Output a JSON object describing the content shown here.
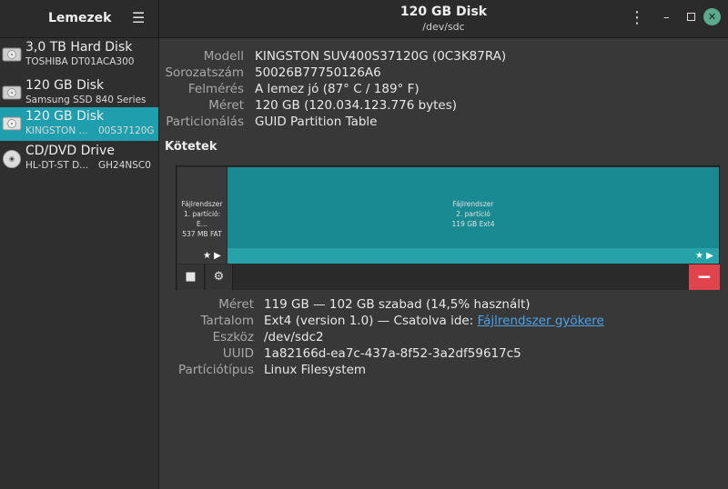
{
  "sidebar": {
    "title": "Lemezek",
    "drives": [
      {
        "name": "3,0 TB Hard Disk",
        "model": "TOSHIBA DT01ACA300",
        "serial": "",
        "icon": "hard-disk-icon"
      },
      {
        "name": "120 GB Disk",
        "model": "Samsung SSD 840 Series",
        "serial": "",
        "icon": "ssd-icon"
      },
      {
        "name": "120 GB Disk",
        "model": "KINGSTON ...",
        "serial": "00S37120G",
        "icon": "ssd-icon",
        "selected": true
      },
      {
        "name": "CD/DVD Drive",
        "model": "HL-DT-ST D...",
        "serial": "GH24NSC0",
        "icon": "optical-disc-icon"
      }
    ]
  },
  "header": {
    "title": "120 GB Disk",
    "subtitle": "/dev/sdc"
  },
  "disk": {
    "rows": [
      {
        "label": "Modell",
        "value": "KINGSTON SUV400S37120G (0C3K87RA)"
      },
      {
        "label": "Sorozatszám",
        "value": "50026B77750126A6"
      },
      {
        "label": "Felmérés",
        "value": "A lemez jó (87° C / 189° F)"
      },
      {
        "label": "Méret",
        "value": "120 GB (120.034.123.776 bytes)"
      },
      {
        "label": "Particionálás",
        "value": "GUID Partition Table"
      }
    ]
  },
  "volumes": {
    "title": "Kötetek",
    "partitions": [
      {
        "line1": "Fájlrendszer",
        "line2": "1. partíció: E...",
        "line3": "537 MB FAT"
      },
      {
        "line1": "Fájlrendszer",
        "line2": "2. partíció",
        "line3": "119 GB Ext4"
      }
    ]
  },
  "details": {
    "size_label": "Méret",
    "size_value": "119 GB — 102 GB szabad (14,5% használt)",
    "content_label": "Tartalom",
    "content_value": "Ext4 (version 1.0) — Csatolva ide: ",
    "content_link": "Fájlrendszer gyökere",
    "device_label": "Eszköz",
    "device_value": "/dev/sdc2",
    "uuid_label": "UUID",
    "uuid_value": "1a82166d-ea7c-437a-8f52-3a2df59617c5",
    "parttype_label": "Partíciótípus",
    "parttype_value": "Linux Filesystem"
  },
  "colors": {
    "accent": "#1f9eae",
    "partition": "#1a8a92",
    "danger": "#e0454d",
    "link": "#4aa3e8"
  }
}
